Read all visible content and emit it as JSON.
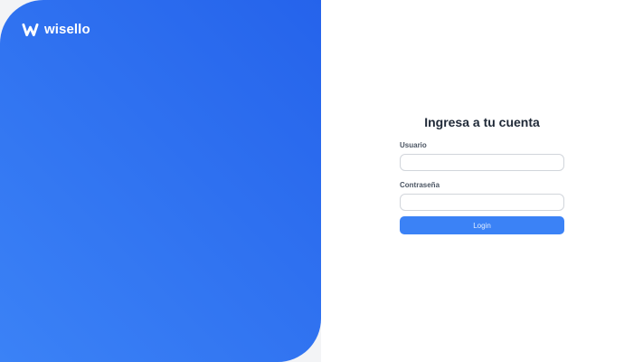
{
  "brand": {
    "name": "wisello",
    "mark_icon": "wisello-w-logo"
  },
  "colors": {
    "accent": "#3b82f6",
    "gradient_start": "#3b82f6",
    "gradient_end": "#2563eb",
    "title_text": "#1f2937"
  },
  "login": {
    "title": "Ingresa a tu cuenta",
    "username_label": "Usuario",
    "username_value": "",
    "password_label": "Contraseña",
    "password_value": "",
    "submit_label": "Login"
  }
}
